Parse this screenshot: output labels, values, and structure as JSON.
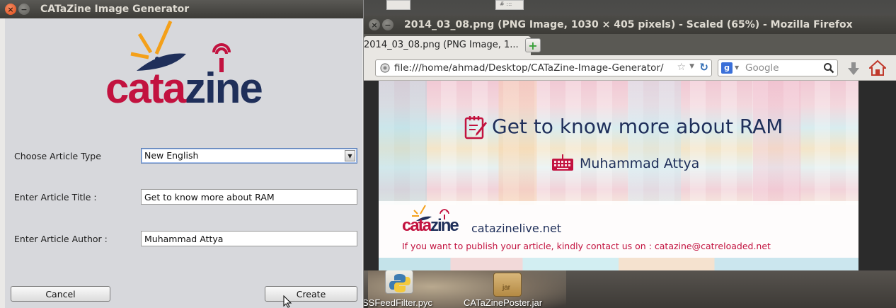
{
  "desktop": {
    "top_tile_label": "# :::",
    "icons": [
      {
        "name": "python-file-icon",
        "label": "SSFeedFilter.pyc"
      },
      {
        "name": "jar-file-icon",
        "label": "CATaZinePoster.jar",
        "badge": "jar"
      }
    ]
  },
  "dialog": {
    "title": "CATaZine Image Generator",
    "logo_text": "catazine",
    "article_type_label": "Choose Article Type",
    "article_type_value": "New English",
    "title_label": "Enter Article Title :",
    "title_value": "Get to know more about RAM",
    "author_label": "Enter Article Author :",
    "author_value": "Muhammad Attya",
    "cancel_label": "Cancel",
    "create_label": "Create"
  },
  "firefox": {
    "window_title": "2014_03_08.png (PNG Image, 1030 × 405 pixels) - Scaled (65%) - Mozilla Firefox",
    "tab_label": "2014_03_08.png (PNG Image, 1...",
    "tab_close": "×",
    "new_tab": "+",
    "url": "file:///home/ahmad/Desktop/CATaZine-Image-Generator/",
    "search_engine": "g",
    "search_placeholder": "Google"
  },
  "poster": {
    "title": "Get to know more about RAM",
    "author": "Muhammad Attya",
    "logo_text": "catazine",
    "site": "catazinelive.net",
    "contact": "If you want to publish your article, kindly contact us on : catazine@catreloaded.net"
  },
  "colors": {
    "brand_red": "#c2123f",
    "brand_navy": "#1f2f5a",
    "brand_orange": "#f4a019",
    "titlebar_dark": "#3c3b37",
    "close_orange": "#df4a16"
  }
}
